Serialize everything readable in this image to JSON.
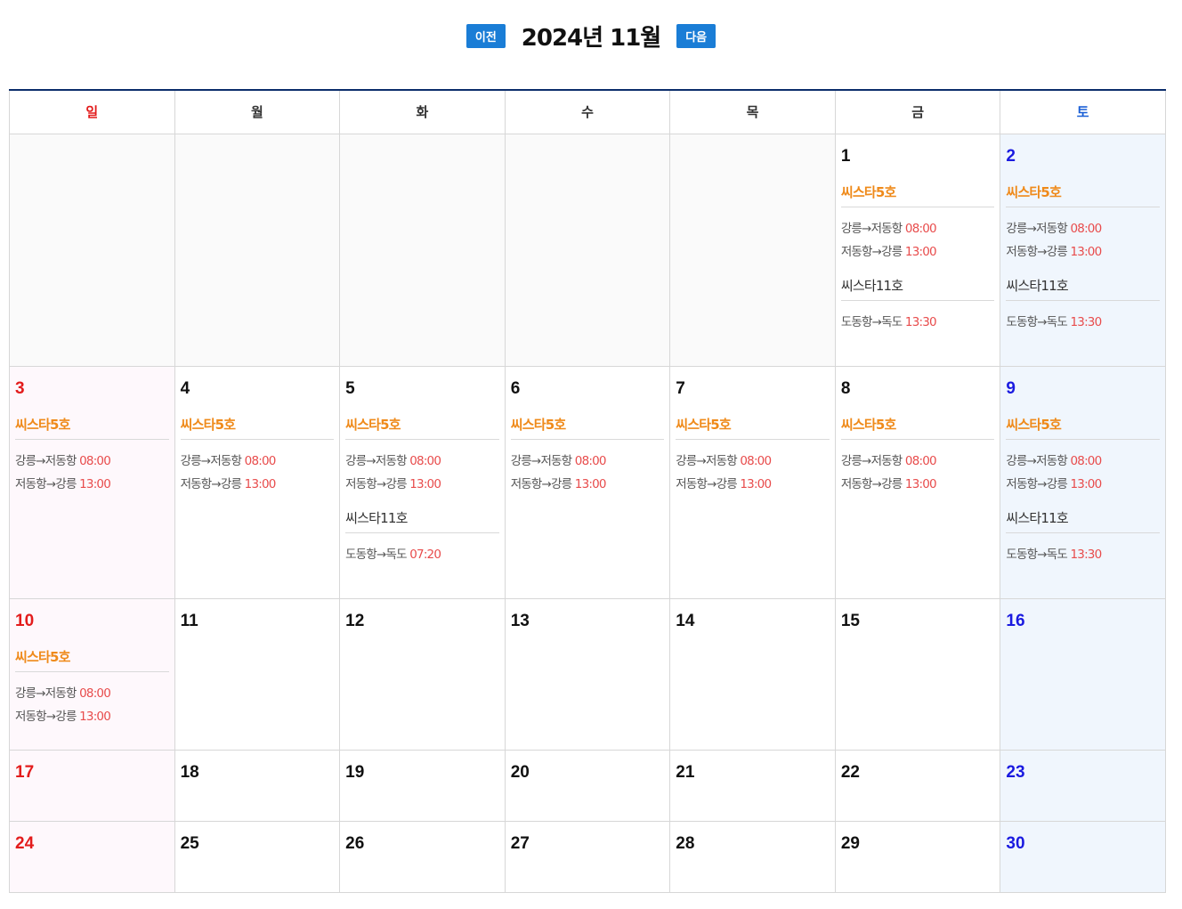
{
  "nav": {
    "prev_label": "이전",
    "title": "2024년 11월",
    "next_label": "다음"
  },
  "weekdays": [
    "일",
    "월",
    "화",
    "수",
    "목",
    "금",
    "토"
  ],
  "weeks": [
    [
      {
        "day": ""
      },
      {
        "day": ""
      },
      {
        "day": ""
      },
      {
        "day": ""
      },
      {
        "day": ""
      },
      {
        "day": "1",
        "ships": [
          {
            "name": "씨스타5호",
            "style": "orange",
            "routes": [
              {
                "route": "강릉→저동항 ",
                "time": "08:00"
              },
              {
                "route": "저동항→강릉 ",
                "time": "13:00"
              }
            ]
          },
          {
            "name": "씨스타11호",
            "style": "dark",
            "routes": [
              {
                "route": "도동항→독도 ",
                "time": "13:30"
              }
            ]
          }
        ]
      },
      {
        "day": "2",
        "ships": [
          {
            "name": "씨스타5호",
            "style": "orange",
            "routes": [
              {
                "route": "강릉→저동항 ",
                "time": "08:00"
              },
              {
                "route": "저동항→강릉 ",
                "time": "13:00"
              }
            ]
          },
          {
            "name": "씨스타11호",
            "style": "dark",
            "routes": [
              {
                "route": "도동항→독도 ",
                "time": "13:30"
              }
            ]
          }
        ]
      }
    ],
    [
      {
        "day": "3",
        "ships": [
          {
            "name": "씨스타5호",
            "style": "orange",
            "routes": [
              {
                "route": "강릉→저동항 ",
                "time": "08:00"
              },
              {
                "route": "저동항→강릉 ",
                "time": "13:00"
              }
            ]
          }
        ]
      },
      {
        "day": "4",
        "ships": [
          {
            "name": "씨스타5호",
            "style": "orange",
            "routes": [
              {
                "route": "강릉→저동항 ",
                "time": "08:00"
              },
              {
                "route": "저동항→강릉 ",
                "time": "13:00"
              }
            ]
          }
        ]
      },
      {
        "day": "5",
        "ships": [
          {
            "name": "씨스타5호",
            "style": "orange",
            "routes": [
              {
                "route": "강릉→저동항 ",
                "time": "08:00"
              },
              {
                "route": "저동항→강릉 ",
                "time": "13:00"
              }
            ]
          },
          {
            "name": "씨스타11호",
            "style": "dark",
            "routes": [
              {
                "route": "도동항→독도 ",
                "time": "07:20"
              }
            ]
          }
        ]
      },
      {
        "day": "6",
        "ships": [
          {
            "name": "씨스타5호",
            "style": "orange",
            "routes": [
              {
                "route": "강릉→저동항 ",
                "time": "08:00"
              },
              {
                "route": "저동항→강릉 ",
                "time": "13:00"
              }
            ]
          }
        ]
      },
      {
        "day": "7",
        "ships": [
          {
            "name": "씨스타5호",
            "style": "orange",
            "routes": [
              {
                "route": "강릉→저동항 ",
                "time": "08:00"
              },
              {
                "route": "저동항→강릉 ",
                "time": "13:00"
              }
            ]
          }
        ]
      },
      {
        "day": "8",
        "ships": [
          {
            "name": "씨스타5호",
            "style": "orange",
            "routes": [
              {
                "route": "강릉→저동항 ",
                "time": "08:00"
              },
              {
                "route": "저동항→강릉 ",
                "time": "13:00"
              }
            ]
          }
        ]
      },
      {
        "day": "9",
        "ships": [
          {
            "name": "씨스타5호",
            "style": "orange",
            "routes": [
              {
                "route": "강릉→저동항 ",
                "time": "08:00"
              },
              {
                "route": "저동항→강릉 ",
                "time": "13:00"
              }
            ]
          },
          {
            "name": "씨스타11호",
            "style": "dark",
            "routes": [
              {
                "route": "도동항→독도 ",
                "time": "13:30"
              }
            ]
          }
        ]
      }
    ],
    [
      {
        "day": "10",
        "ships": [
          {
            "name": "씨스타5호",
            "style": "orange",
            "routes": [
              {
                "route": "강릉→저동항 ",
                "time": "08:00"
              },
              {
                "route": "저동항→강릉 ",
                "time": "13:00"
              }
            ]
          }
        ]
      },
      {
        "day": "11"
      },
      {
        "day": "12"
      },
      {
        "day": "13"
      },
      {
        "day": "14"
      },
      {
        "day": "15"
      },
      {
        "day": "16"
      }
    ],
    [
      {
        "day": "17"
      },
      {
        "day": "18"
      },
      {
        "day": "19"
      },
      {
        "day": "20"
      },
      {
        "day": "21"
      },
      {
        "day": "22"
      },
      {
        "day": "23"
      }
    ],
    [
      {
        "day": "24"
      },
      {
        "day": "25"
      },
      {
        "day": "26"
      },
      {
        "day": "27"
      },
      {
        "day": "28"
      },
      {
        "day": "29"
      },
      {
        "day": "30"
      }
    ]
  ]
}
